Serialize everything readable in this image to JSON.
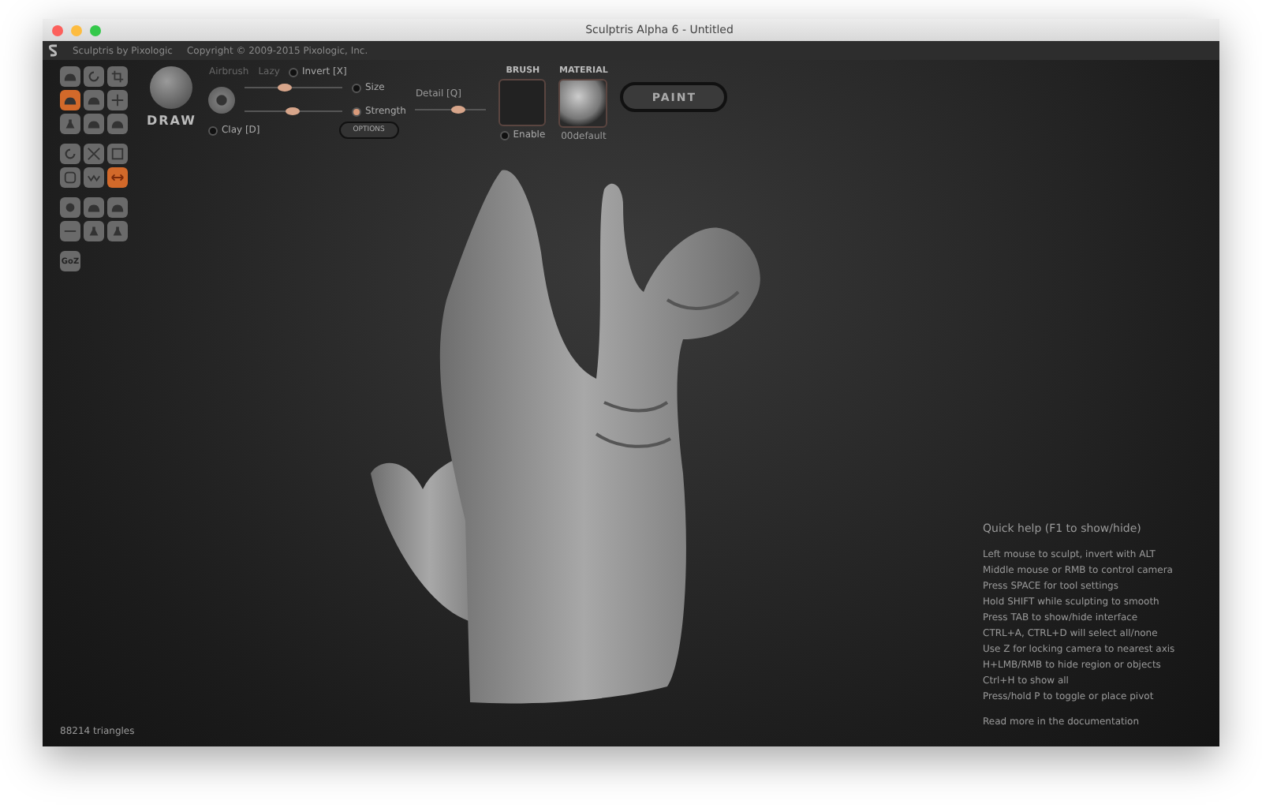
{
  "window": {
    "title": "Sculptris Alpha 6 - Untitled"
  },
  "header": {
    "app": "Sculptris by Pixologic",
    "copyright": "Copyright © 2009-2015 Pixologic, Inc."
  },
  "tool_groups": [
    [
      {
        "kind": "mound",
        "selected": false
      },
      {
        "kind": "rotate",
        "selected": false
      },
      {
        "kind": "crop",
        "selected": false
      },
      {
        "kind": "mound",
        "selected": true
      },
      {
        "kind": "mound",
        "selected": false
      },
      {
        "kind": "move",
        "selected": false
      },
      {
        "kind": "pinch",
        "selected": false
      },
      {
        "kind": "mound",
        "selected": false
      },
      {
        "kind": "mound",
        "selected": false
      }
    ],
    [
      {
        "kind": "rotate",
        "selected": false
      },
      {
        "kind": "cross",
        "selected": false
      },
      {
        "kind": "grid",
        "selected": false
      },
      {
        "kind": "square",
        "selected": false
      },
      {
        "kind": "wave",
        "selected": false
      },
      {
        "kind": "arrows",
        "selected": true
      }
    ],
    [
      {
        "kind": "ball",
        "selected": false
      },
      {
        "kind": "mound",
        "selected": false
      },
      {
        "kind": "mound",
        "selected": false
      },
      {
        "kind": "dash",
        "selected": false
      },
      {
        "kind": "pinch",
        "selected": false
      },
      {
        "kind": "pinch",
        "selected": false
      }
    ],
    [
      {
        "kind": "text",
        "label": "GoZ",
        "selected": false
      }
    ]
  ],
  "brush_panel": {
    "tool_name": "DRAW",
    "airbrush": "Airbrush",
    "lazy": "Lazy",
    "invert": {
      "label": "Invert [X]",
      "checked": false
    },
    "clay": {
      "label": "Clay [D]",
      "checked": false
    },
    "sliders": [
      {
        "label": "Size",
        "level": 0.4,
        "selected": false
      },
      {
        "label": "Strength",
        "level": 0.48,
        "selected": true
      }
    ],
    "detail": {
      "label": "Detail [Q]",
      "level": 0.6
    },
    "options": "OPTIONS"
  },
  "brush": {
    "label": "BRUSH",
    "enable": {
      "label": "Enable",
      "checked": false
    }
  },
  "material": {
    "label": "MATERIAL",
    "name": "00default"
  },
  "paint_button": "PAINT",
  "quick_help": {
    "title": "Quick help (F1 to show/hide)",
    "lines": [
      "Left mouse to sculpt, invert with ALT",
      "Middle mouse or RMB to control camera",
      "Press SPACE for tool settings",
      "Hold SHIFT while sculpting to smooth",
      "Press TAB to show/hide interface",
      "CTRL+A, CTRL+D will select all/none",
      "Use Z for locking camera to nearest axis",
      "H+LMB/RMB to hide region or objects",
      "Ctrl+H to show all",
      "Press/hold P to toggle or place pivot"
    ],
    "link": "Read more in the documentation"
  },
  "status": "88214 triangles"
}
